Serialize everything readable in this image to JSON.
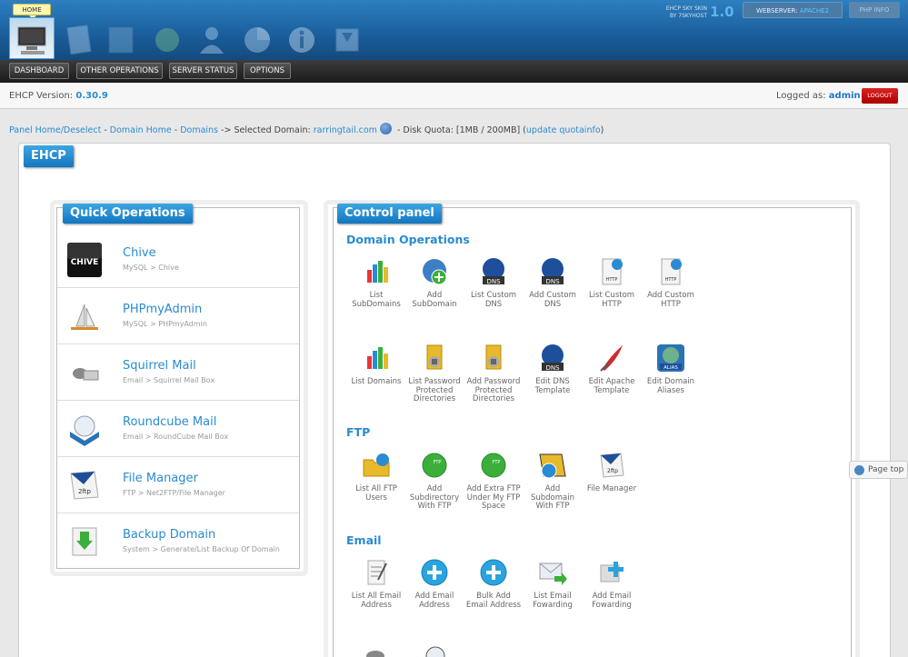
{
  "header": {
    "home_tab": "HOME",
    "skin_brand_line1": "EHCP SKY SKIN",
    "skin_brand_line2": "BY 7SKYHOST",
    "skin_version": "1.0",
    "webserver_label": "WEBSERVER:",
    "webserver_value": "APACHE2",
    "phpinfo_label": "PHP INFO"
  },
  "nav": {
    "dashboard": "DASHBOARD",
    "other_operations": "OTHER OPERATIONS",
    "server_status": "SERVER STATUS",
    "options": "OPTIONS"
  },
  "infobar": {
    "version_label": "EHCP Version:",
    "version_value": "0.30.9",
    "logged_as_label": "Logged as:",
    "user": "admin",
    "logout": "LOGOUT"
  },
  "breadcrumb": {
    "panel_home": "Panel Home/Deselect",
    "sep1": " - ",
    "domain_home": "Domain Home",
    "sep2": " - ",
    "domains": "Domains",
    "selected_label": " -> Selected Domain: ",
    "domain": "rarringtail.com",
    "quota_label": " - Disk Quota: [1MB / 200MB] (",
    "update_quota": "update quotainfo",
    "close": ")"
  },
  "main": {
    "ehcp_tab": "EHCP",
    "quick_title": "Quick Operations",
    "control_title": "Control panel"
  },
  "quick_ops": [
    {
      "title": "Chive",
      "sub": "MySQL > Chive",
      "icon_text": "CHIVE"
    },
    {
      "title": "PHPmyAdmin",
      "sub": "MySQL > PHPmyAdmin"
    },
    {
      "title": "Squirrel Mail",
      "sub": "Email > Squirrel Mail Box"
    },
    {
      "title": "Roundcube Mail",
      "sub": "Email > RoundCube Mail Box"
    },
    {
      "title": "File Manager",
      "sub": "FTP > Net2FTP/File Manager"
    },
    {
      "title": "Backup Domain",
      "sub": "System > Generate/List Backup Of Domain"
    }
  ],
  "groups": {
    "domain_ops": "Domain Operations",
    "ftp": "FTP",
    "email": "Email"
  },
  "domain_ops": [
    {
      "l1": "List",
      "l2": "SubDomains",
      "l3": ""
    },
    {
      "l1": "Add",
      "l2": "SubDomain",
      "l3": ""
    },
    {
      "l1": "List Custom",
      "l2": "DNS",
      "l3": ""
    },
    {
      "l1": "Add Custom",
      "l2": "DNS",
      "l3": ""
    },
    {
      "l1": "List Custom",
      "l2": "HTTP",
      "l3": ""
    },
    {
      "l1": "Add Custom",
      "l2": "HTTP",
      "l3": ""
    },
    {
      "l1": "List Domains",
      "l2": "",
      "l3": ""
    },
    {
      "l1": "List Password",
      "l2": "Protected",
      "l3": "Directories"
    },
    {
      "l1": "Add Password",
      "l2": "Protected",
      "l3": "Directories"
    },
    {
      "l1": "Edit DNS",
      "l2": "Template",
      "l3": ""
    },
    {
      "l1": "Edit Apache",
      "l2": "Template",
      "l3": ""
    },
    {
      "l1": "Edit Domain",
      "l2": "Aliases",
      "l3": ""
    }
  ],
  "ftp_ops": [
    {
      "l1": "List All FTP",
      "l2": "Users",
      "l3": ""
    },
    {
      "l1": "Add",
      "l2": "Subdirectory",
      "l3": "With FTP"
    },
    {
      "l1": "Add Extra FTP",
      "l2": "Under My FTP",
      "l3": "Space"
    },
    {
      "l1": "Add",
      "l2": "Subdomain",
      "l3": "With FTP"
    },
    {
      "l1": "File Manager",
      "l2": "",
      "l3": ""
    }
  ],
  "email_ops": [
    {
      "l1": "List All Email",
      "l2": "Address",
      "l3": ""
    },
    {
      "l1": "Add Email",
      "l2": "Address",
      "l3": ""
    },
    {
      "l1": "Bulk Add",
      "l2": "Email Address",
      "l3": ""
    },
    {
      "l1": "List Email",
      "l2": "Fowarding",
      "l3": ""
    },
    {
      "l1": "Add Email",
      "l2": "Fowarding",
      "l3": ""
    }
  ],
  "icon_badges": {
    "dns": "DNS",
    "http": "HTTP",
    "alias": "ALIAS",
    "ftp": "FTP",
    "twoftp": "2ftp"
  },
  "page_top": "Page top",
  "colors": {
    "accent": "#2a8bd2",
    "header": "#1a5d9a",
    "logout": "#cc1111"
  }
}
